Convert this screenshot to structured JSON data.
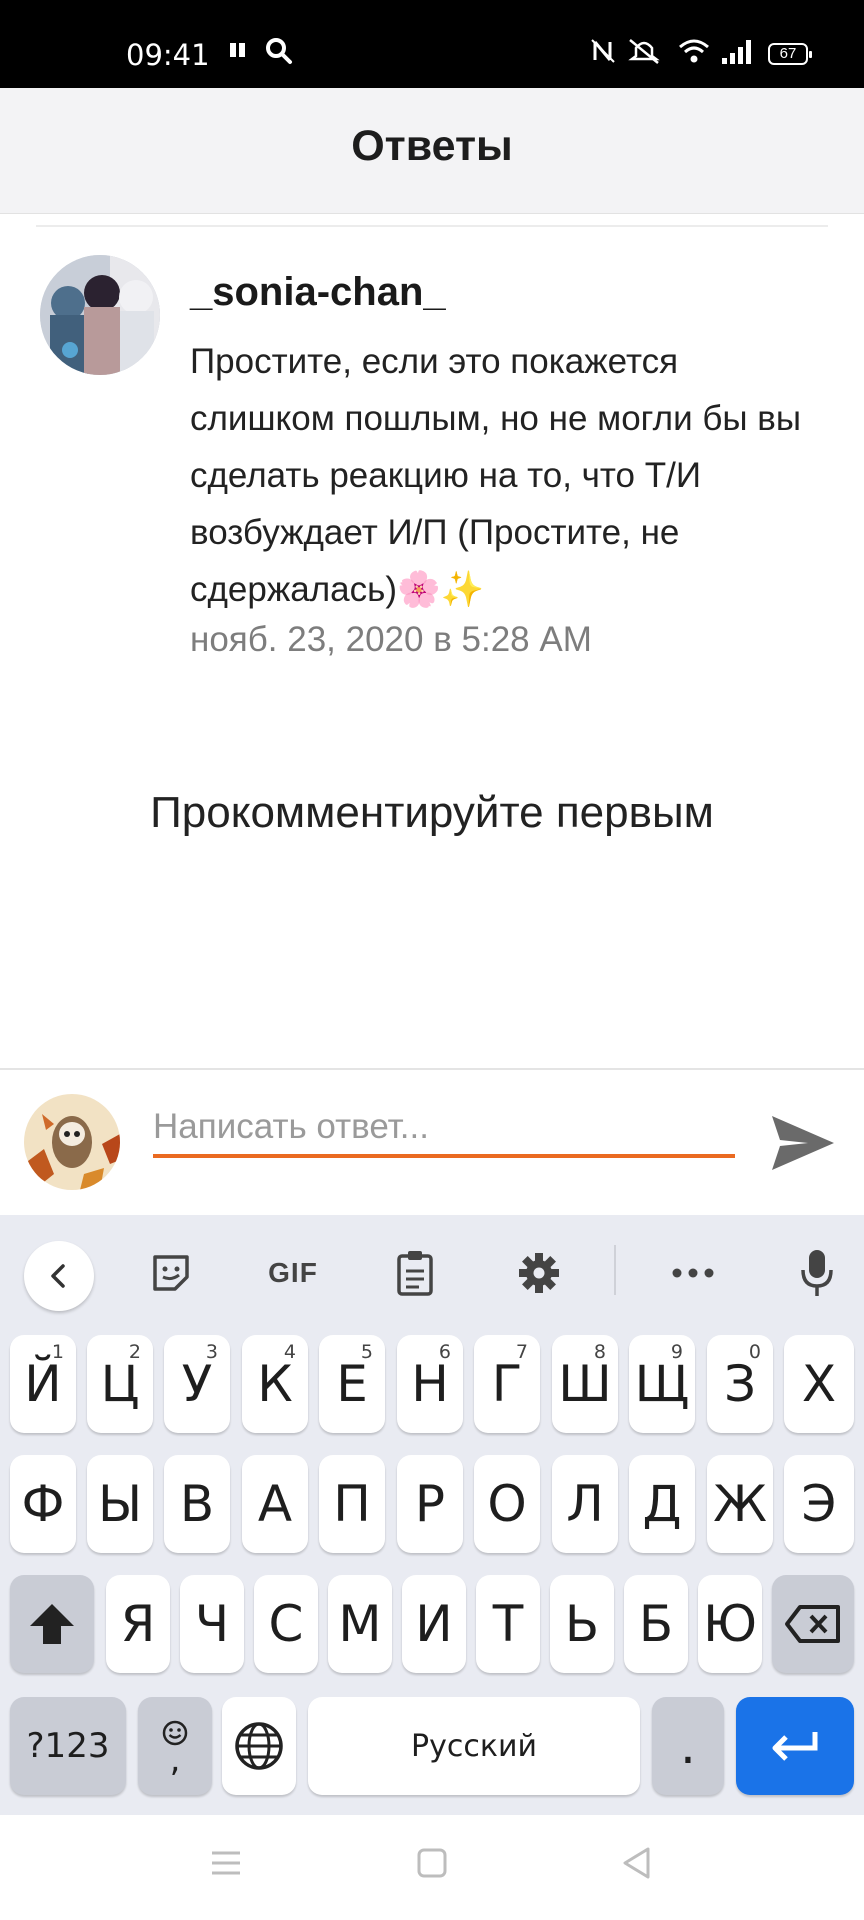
{
  "status": {
    "time": "09:41",
    "battery": "67"
  },
  "header": {
    "title": "Ответы"
  },
  "post": {
    "username": "_sonia-chan_",
    "text": "Простите, если это покажется слишком пошлым, но не могли бы вы сделать реакцию на то, что Т/И возбуждает И/П (Простите, не сдержалась)🌸✨",
    "timestamp": "нояб. 23, 2020 в 5:28 AM"
  },
  "empty_state": "Прокомментируйте первым",
  "reply": {
    "placeholder": "Написать ответ..."
  },
  "keyboard": {
    "gif_label": "GIF",
    "row1": [
      {
        "k": "Й",
        "h": "1"
      },
      {
        "k": "Ц",
        "h": "2"
      },
      {
        "k": "У",
        "h": "3"
      },
      {
        "k": "К",
        "h": "4"
      },
      {
        "k": "Е",
        "h": "5"
      },
      {
        "k": "Н",
        "h": "6"
      },
      {
        "k": "Г",
        "h": "7"
      },
      {
        "k": "Ш",
        "h": "8"
      },
      {
        "k": "Щ",
        "h": "9"
      },
      {
        "k": "З",
        "h": "0"
      },
      {
        "k": "Х",
        "h": ""
      }
    ],
    "row2": [
      "Ф",
      "Ы",
      "В",
      "А",
      "П",
      "Р",
      "О",
      "Л",
      "Д",
      "Ж",
      "Э"
    ],
    "row3": [
      "Я",
      "Ч",
      "С",
      "М",
      "И",
      "Т",
      "Ь",
      "Б",
      "Ю"
    ],
    "symbols_label": "?123",
    "comma_label": ",",
    "space_label": "Русский",
    "period_label": "."
  }
}
